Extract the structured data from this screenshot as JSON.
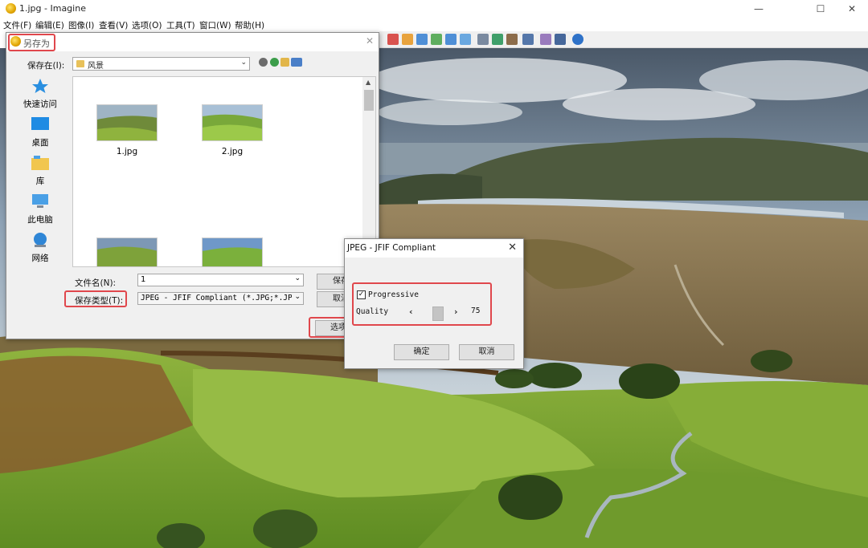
{
  "window": {
    "title": "1.jpg - Imagine",
    "minimize": "—",
    "maximize": "☐",
    "close": "✕"
  },
  "menubar": [
    {
      "label": "文件(F)"
    },
    {
      "label": "编辑(E)"
    },
    {
      "label": "图像(I)"
    },
    {
      "label": "查看(V)"
    },
    {
      "label": "选项(O)"
    },
    {
      "label": "工具(T)"
    },
    {
      "label": "窗口(W)"
    },
    {
      "label": "帮助(H)"
    }
  ],
  "toolbar_icons": [
    "pointer-icon",
    "zoom-icon",
    "copy-image-icon",
    "paste-image-icon",
    "resize-icon",
    "crop-icon",
    "monitor-icon",
    "capture-icon",
    "adjust-icon",
    "plugin-icon",
    "batch-icon",
    "convert-icon",
    "info-icon"
  ],
  "save_dialog": {
    "title": "另存为",
    "close": "✕",
    "save_in_label": "保存在(I):",
    "save_in_value": "风景",
    "places": [
      {
        "label": "快速访问",
        "icon": "star-icon"
      },
      {
        "label": "桌面",
        "icon": "desktop-icon"
      },
      {
        "label": "库",
        "icon": "library-icon"
      },
      {
        "label": "此电脑",
        "icon": "computer-icon"
      },
      {
        "label": "网络",
        "icon": "network-icon"
      }
    ],
    "files": [
      {
        "name": "1.jpg"
      },
      {
        "name": "2.jpg"
      },
      {
        "name": ""
      },
      {
        "name": ""
      }
    ],
    "filename_label": "文件名(N):",
    "filename_value": "1",
    "filetype_label": "保存类型(T):",
    "filetype_value": "JPEG - JFIF Compliant (*.JPG;*.JPEG;*.",
    "save_button": "保存",
    "cancel_button": "取消",
    "options_button": "选项"
  },
  "jpeg_dialog": {
    "title": "JPEG - JFIF Compliant",
    "close": "✕",
    "progressive_label": "Progressive",
    "progressive_checked": true,
    "check_mark": "✓",
    "quality_label": "Quality",
    "quality_value": "75",
    "slider_left": "‹",
    "slider_right": "›",
    "ok_button": "确定",
    "cancel_button": "取消"
  }
}
